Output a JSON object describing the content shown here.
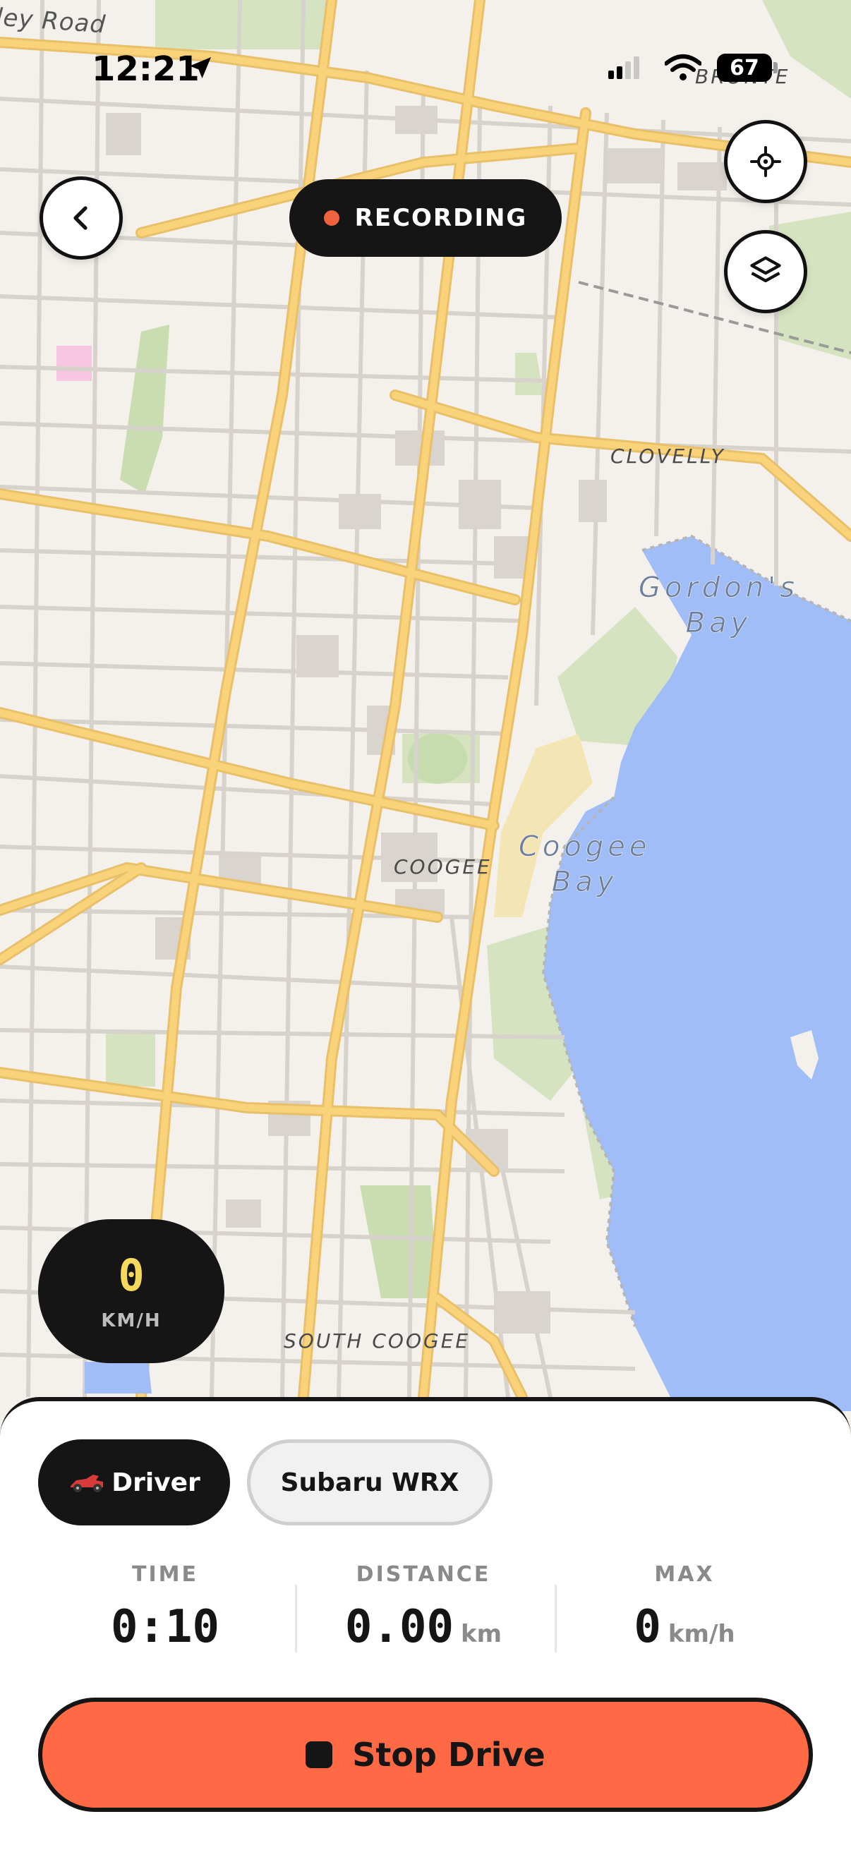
{
  "status_bar": {
    "time": "12:21",
    "battery": "67",
    "icons": [
      "location-arrow-icon",
      "cellular-signal-icon",
      "wifi-icon",
      "battery-icon"
    ]
  },
  "map": {
    "labels": {
      "road": "ley Road",
      "bronte": "BRONTE",
      "clovelly": "CLOVELLY",
      "gordons_bay": "Gordon's\nBay",
      "coogee": "COOGEE",
      "coogee_bay": "Coogee\nBay",
      "south_coogee": "SOUTH COOGEE"
    },
    "colors": {
      "land": "#f4f1ec",
      "water": "#a0bdf7",
      "major_road": "#f9d27a",
      "park": "#d6e3c0",
      "beach": "#f3e6b4"
    }
  },
  "controls": {
    "recording_label": "RECORDING",
    "recording_color": "#f0623e",
    "back_icon": "chevron-left-icon",
    "locate_icon": "crosshair-icon",
    "layers_icon": "layers-icon"
  },
  "speed": {
    "value": "0",
    "unit": "KM/H"
  },
  "sheet": {
    "chips": [
      {
        "label": "Driver",
        "icon": "race-car-icon",
        "selected": true
      },
      {
        "label": "Subaru WRX",
        "selected": false
      }
    ],
    "stats": {
      "time": {
        "label": "TIME",
        "value": "0:10"
      },
      "distance": {
        "label": "DISTANCE",
        "value": "0.00",
        "unit": "km"
      },
      "max": {
        "label": "MAX",
        "value": "0",
        "unit": "km/h"
      }
    },
    "stop_button": {
      "label": "Stop Drive",
      "color": "#ff6a45"
    }
  }
}
